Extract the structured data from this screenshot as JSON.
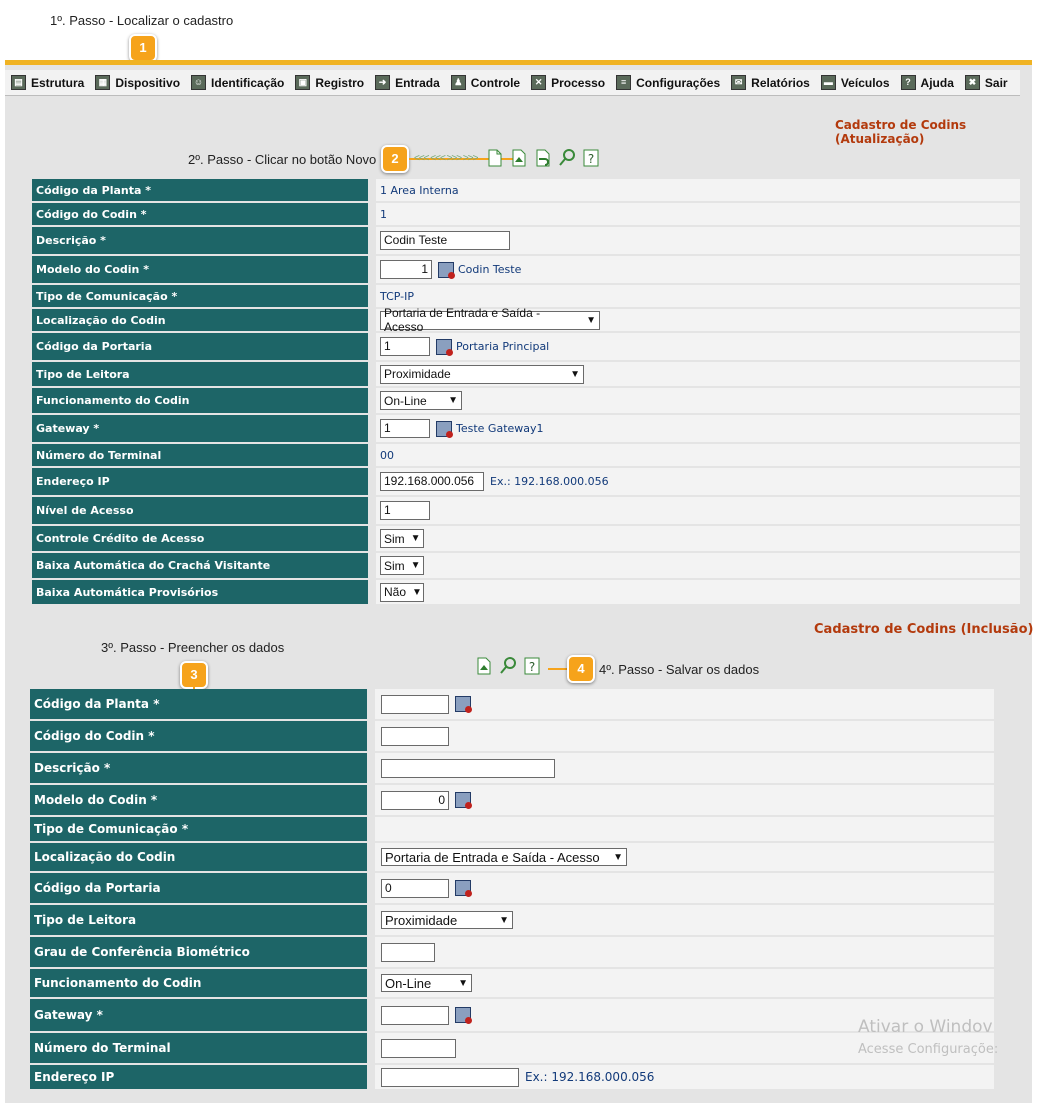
{
  "steps": {
    "step1": "1º. Passo - Localizar o cadastro",
    "step2": "2º. Passo - Clicar no botão Novo",
    "step3": "3º. Passo - Preencher os dados",
    "step4": "4º. Passo - Salvar os dados",
    "bubble1": "1",
    "bubble2": "2",
    "bubble3": "3",
    "bubble4": "4"
  },
  "menu": [
    "Estrutura",
    "Dispositivo",
    "Identificação",
    "Registro",
    "Entrada",
    "Controle",
    "Processo",
    "Configurações",
    "Relatórios",
    "Veículos",
    "Ajuda",
    "Sair"
  ],
  "update": {
    "title": "Cadastro de Codins (Atualização)",
    "codigo_planta_label": "Código da Planta *",
    "codigo_planta_value": "1 Area Interna",
    "codigo_codin_label": "Código do Codin *",
    "codigo_codin_value": "1",
    "descricao_label": "Descrição *",
    "descricao_value": "Codin Teste",
    "modelo_label": "Modelo do Codin *",
    "modelo_value": "1",
    "modelo_link": "Codin Teste",
    "tipo_com_label": "Tipo de Comunicação *",
    "tipo_com_value": "TCP-IP",
    "localizacao_label": "Localização do Codin",
    "localizacao_value": "Portaria de Entrada e Saída - Acesso",
    "portaria_label": "Código da Portaria",
    "portaria_value": "1",
    "portaria_link": "Portaria Principal",
    "leitora_label": "Tipo de Leitora",
    "leitora_value": "Proximidade",
    "funcionamento_label": "Funcionamento do Codin",
    "funcionamento_value": "On-Line",
    "gateway_label": "Gateway *",
    "gateway_value": "1",
    "gateway_link": "Teste Gateway1",
    "terminal_label": "Número do Terminal",
    "terminal_value": "00",
    "ip_label": "Endereço IP",
    "ip_value": "192.168.000.056",
    "ip_hint": "Ex.: 192.168.000.056",
    "nivel_label": "Nível de Acesso",
    "nivel_value": "1",
    "credito_label": "Controle Crédito de Acesso",
    "credito_value": "Sim",
    "baixa_cracha_label": "Baixa Automática do Crachá Visitante",
    "baixa_cracha_value": "Sim",
    "baixa_prov_label": "Baixa Automática Provisórios",
    "baixa_prov_value": "Não"
  },
  "insert": {
    "title": "Cadastro de Codins (Inclusão)",
    "codigo_planta_label": "Código da Planta *",
    "codigo_codin_label": "Código do Codin *",
    "descricao_label": "Descrição *",
    "modelo_label": "Modelo do Codin *",
    "modelo_value": "0",
    "tipo_com_label": "Tipo de Comunicação *",
    "localizacao_label": "Localização do Codin",
    "localizacao_value": "Portaria de Entrada e Saída - Acesso",
    "portaria_label": "Código da Portaria",
    "portaria_value": "0",
    "leitora_label": "Tipo de Leitora",
    "leitora_value": "Proximidade",
    "grau_label": "Grau de Conferência Biométrico",
    "funcionamento_label": "Funcionamento do Codin",
    "funcionamento_value": "On-Line",
    "gateway_label": "Gateway *",
    "terminal_label": "Número do Terminal",
    "ip_label": "Endereço IP",
    "ip_hint": "Ex.: 192.168.000.056"
  },
  "watermark": {
    "line1": "Ativar o Windov",
    "line2": "Acesse Configuraçõe:"
  },
  "colors": {
    "label_bg": "#1d6567",
    "accent": "#f0b323",
    "title": "#b33a0d"
  }
}
